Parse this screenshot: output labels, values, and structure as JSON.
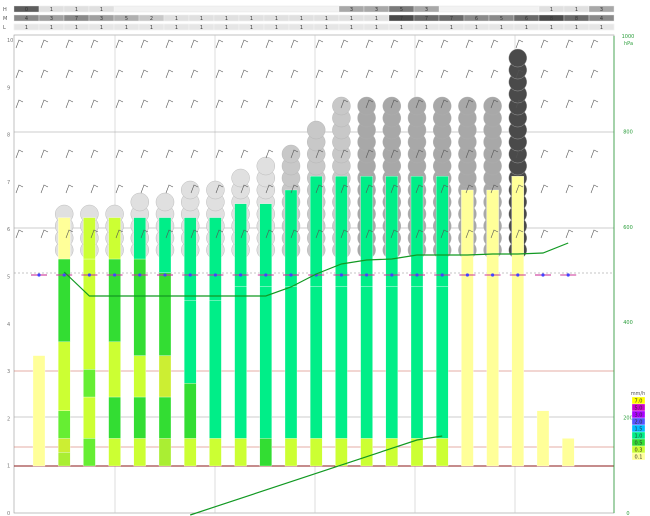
{
  "chart_data": {
    "type": "heatmap",
    "title": "",
    "cloud_rows": [
      {
        "label": "H",
        "cells": [
          [
            0,
            "#5e5e5e",
            "0"
          ],
          [
            1,
            "#e0e0e0",
            "1"
          ],
          [
            2,
            "#e0e0e0",
            "1"
          ],
          [
            3,
            "#e0e0e0",
            "1"
          ],
          [
            13,
            "#a8a8a8",
            "3"
          ],
          [
            14,
            "#a8a8a8",
            "3"
          ],
          [
            15,
            "#7a7a7a",
            "5"
          ],
          [
            16,
            "#a8a8a8",
            "3"
          ],
          [
            21,
            "#e0e0e0",
            "1"
          ],
          [
            22,
            "#e0e0e0",
            "1"
          ],
          [
            23,
            "#a8a8a8",
            "3"
          ]
        ]
      },
      {
        "label": "M",
        "cells": [
          [
            0,
            "#8a8a8a",
            "4"
          ],
          [
            1,
            "#a0a0a0",
            "3"
          ],
          [
            2,
            "#8a8a8a",
            "7"
          ],
          [
            3,
            "#a0a0a0",
            "3"
          ],
          [
            4,
            "#b0b0b0",
            "5"
          ],
          [
            5,
            "#c8c8c8",
            "2"
          ],
          [
            6,
            "#e0e0e0",
            "1"
          ],
          [
            7,
            "#e0e0e0",
            "1"
          ],
          [
            8,
            "#e0e0e0",
            "1"
          ],
          [
            9,
            "#e0e0e0",
            "1"
          ],
          [
            10,
            "#e0e0e0",
            "1"
          ],
          [
            11,
            "#e0e0e0",
            "1"
          ],
          [
            12,
            "#e0e0e0",
            "1"
          ],
          [
            13,
            "#e0e0e0",
            "1"
          ],
          [
            14,
            "#e0e0e0",
            "1"
          ],
          [
            15,
            "#4a4a4a",
            "7"
          ],
          [
            16,
            "#6a6a6a",
            "7"
          ],
          [
            17,
            "#6a6a6a",
            "7"
          ],
          [
            18,
            "#8a8a8a",
            "6"
          ],
          [
            19,
            "#8a8a8a",
            "5"
          ],
          [
            20,
            "#6a6a6a",
            "6"
          ],
          [
            21,
            "#4a4a4a",
            "8"
          ],
          [
            22,
            "#6a6a6a",
            "8"
          ],
          [
            23,
            "#8a8a8a",
            "4"
          ]
        ]
      },
      {
        "label": "L",
        "cells": [
          [
            0,
            "#e6e6e6",
            "1"
          ],
          [
            1,
            "#e6e6e6",
            "1"
          ],
          [
            2,
            "#e6e6e6",
            "1"
          ],
          [
            3,
            "#e6e6e6",
            "1"
          ],
          [
            4,
            "#e6e6e6",
            "1"
          ],
          [
            5,
            "#e6e6e6",
            "1"
          ],
          [
            6,
            "#e6e6e6",
            "1"
          ],
          [
            7,
            "#e6e6e6",
            "1"
          ],
          [
            8,
            "#e6e6e6",
            "1"
          ],
          [
            9,
            "#e6e6e6",
            "1"
          ],
          [
            10,
            "#e6e6e6",
            "1"
          ],
          [
            11,
            "#e6e6e6",
            "1"
          ],
          [
            12,
            "#e6e6e6",
            "1"
          ],
          [
            13,
            "#e6e6e6",
            "1"
          ],
          [
            14,
            "#e6e6e6",
            "1"
          ],
          [
            15,
            "#e6e6e6",
            "1"
          ],
          [
            16,
            "#e6e6e6",
            "1"
          ],
          [
            17,
            "#e6e6e6",
            "1"
          ],
          [
            18,
            "#e6e6e6",
            "1"
          ],
          [
            19,
            "#e6e6e6",
            "1"
          ],
          [
            20,
            "#e6e6e6",
            "1"
          ],
          [
            21,
            "#e6e6e6",
            "1"
          ],
          [
            22,
            "#e6e6e6",
            "1"
          ],
          [
            23,
            "#e6e6e6",
            "1"
          ]
        ]
      }
    ],
    "left_levels": [
      "10",
      "9",
      "8",
      "7",
      "6",
      "5",
      "4",
      "3",
      "2",
      "1",
      "0"
    ],
    "right_levels": [
      "1000",
      "800",
      "600",
      "400",
      "200",
      "0"
    ],
    "right_unit": "hPa",
    "profile_columns": [
      {
        "tower": 0,
        "color": "#ffff99",
        "bars": 8,
        "low": []
      },
      {
        "tower": 4,
        "color": "#ffff99",
        "bars": 18,
        "low": [
          [
            "#33dd33",
            6
          ],
          [
            "#ccff33",
            5
          ],
          [
            "#66ee33",
            2
          ],
          [
            "#ccee33",
            1
          ],
          [
            "#aaee33",
            1
          ]
        ]
      },
      {
        "tower": 4,
        "color": "#ccff33",
        "bars": 18,
        "low": [
          [
            "#ccff33",
            8
          ],
          [
            "#66ee33",
            2
          ],
          [
            "#ccff33",
            3
          ],
          [
            "#66ee33",
            2
          ]
        ]
      },
      {
        "tower": 4,
        "color": "#ccff33",
        "bars": 18,
        "low": [
          [
            "#33dd33",
            6
          ],
          [
            "#ccff33",
            4
          ],
          [
            "#33dd33",
            3
          ],
          [
            "#ccff33",
            2
          ]
        ]
      },
      {
        "tower": 5,
        "color": "#00ee88",
        "bars": 18,
        "low": [
          [
            "#33dd33",
            7
          ],
          [
            "#ccff33",
            3
          ],
          [
            "#33dd33",
            3
          ],
          [
            "#ccff33",
            2
          ]
        ]
      },
      {
        "tower": 5,
        "color": "#00ee88",
        "bars": 18,
        "low": [
          [
            "#33dd33",
            6
          ],
          [
            "#ccee33",
            3
          ],
          [
            "#33dd33",
            3
          ],
          [
            "#aaee33",
            2
          ]
        ]
      },
      {
        "tower": 6,
        "color": "#00ee88",
        "bars": 18,
        "low": [
          [
            "#00ee88",
            6
          ],
          [
            "#33dd33",
            4
          ],
          [
            "#ccff33",
            2
          ]
        ]
      },
      {
        "tower": 6,
        "color": "#00ee88",
        "bars": 18,
        "low": [
          [
            "#00ee88",
            10
          ],
          [
            "#ccff33",
            2
          ]
        ]
      },
      {
        "tower": 7,
        "color": "#00ee88",
        "bars": 19,
        "low": [
          [
            "#00ee88",
            11
          ],
          [
            "#ccff33",
            2
          ]
        ]
      },
      {
        "tower": 8,
        "color": "#00ee88",
        "bars": 19,
        "low": [
          [
            "#00ee88",
            11
          ],
          [
            "#33dd33",
            2
          ]
        ]
      },
      {
        "tower": 9,
        "color": "#00ee88",
        "bars": 20,
        "low": [
          [
            "#00ee88",
            11
          ],
          [
            "#ccff33",
            2
          ]
        ]
      },
      {
        "tower": 11,
        "color": "#00ee88",
        "bars": 21,
        "low": [
          [
            "#00ee88",
            11
          ],
          [
            "#ccff33",
            2
          ]
        ]
      },
      {
        "tower": 13,
        "color": "#00ee88",
        "bars": 21,
        "low": [
          [
            "#00ee88",
            11
          ],
          [
            "#ccff33",
            2
          ]
        ]
      },
      {
        "tower": 13,
        "color": "#00ee88",
        "bars": 21,
        "low": [
          [
            "#00ee88",
            11
          ],
          [
            "#ccff33",
            2
          ]
        ]
      },
      {
        "tower": 13,
        "color": "#00ee88",
        "bars": 21,
        "low": [
          [
            "#00ee88",
            11
          ],
          [
            "#ccff33",
            2
          ]
        ]
      },
      {
        "tower": 13,
        "color": "#00ee88",
        "bars": 21,
        "low": [
          [
            "#00ee88",
            11
          ],
          [
            "#ccff33",
            2
          ]
        ]
      },
      {
        "tower": 13,
        "color": "#00ee88",
        "bars": 21,
        "low": [
          [
            "#00ee88",
            11
          ],
          [
            "#ccff33",
            2
          ]
        ]
      },
      {
        "tower": 13,
        "color": "#ffff99",
        "bars": 20,
        "low": []
      },
      {
        "tower": 13,
        "color": "#ffff99",
        "bars": 20,
        "low": []
      },
      {
        "tower": 17,
        "color": "#ffff99",
        "bars": 21,
        "low": []
      },
      {
        "tower": 0,
        "color": "#ffff99",
        "bars": 4,
        "low": []
      },
      {
        "tower": 0,
        "color": "#ffff99",
        "bars": 2,
        "low": []
      }
    ],
    "legend_title": "mm/h",
    "legend": [
      {
        "color": "#ffff00",
        "label": "7.0"
      },
      {
        "color": "#cc00cc",
        "label": "5.0"
      },
      {
        "color": "#aa00ff",
        "label": "3.0"
      },
      {
        "color": "#5555ff",
        "label": "2.0"
      },
      {
        "color": "#00bbff",
        "label": "1.5"
      },
      {
        "color": "#00ee88",
        "label": "1.0"
      },
      {
        "color": "#33dd33",
        "label": "0.5"
      },
      {
        "color": "#ccff33",
        "label": "0.3"
      },
      {
        "color": "#ffff99",
        "label": "0.1"
      }
    ],
    "temp_line": [
      [
        1,
        272
      ],
      [
        2,
        296
      ],
      [
        3,
        296
      ],
      [
        4,
        296
      ],
      [
        6,
        296
      ],
      [
        8,
        296
      ],
      [
        9,
        296
      ],
      [
        10,
        287
      ],
      [
        11,
        274
      ],
      [
        12,
        264
      ],
      [
        13,
        260
      ],
      [
        14,
        259
      ],
      [
        15,
        255
      ],
      [
        16,
        255
      ],
      [
        17,
        255
      ],
      [
        18,
        254
      ],
      [
        19,
        254
      ],
      [
        20,
        253
      ],
      [
        21,
        243
      ]
    ],
    "low_line": [
      [
        6,
        515
      ],
      [
        15,
        440
      ],
      [
        16,
        436
      ]
    ],
    "cloud_grey_levels": [
      "#e0e0e0",
      "#c8c8c8",
      "#a8a8a8",
      "#4a4a4a"
    ],
    "tower_heights": [
      0,
      0,
      0,
      0,
      0,
      0,
      0,
      0,
      0,
      0,
      0,
      0,
      0,
      0,
      0,
      0,
      0,
      0,
      0,
      0,
      0,
      0
    ]
  }
}
